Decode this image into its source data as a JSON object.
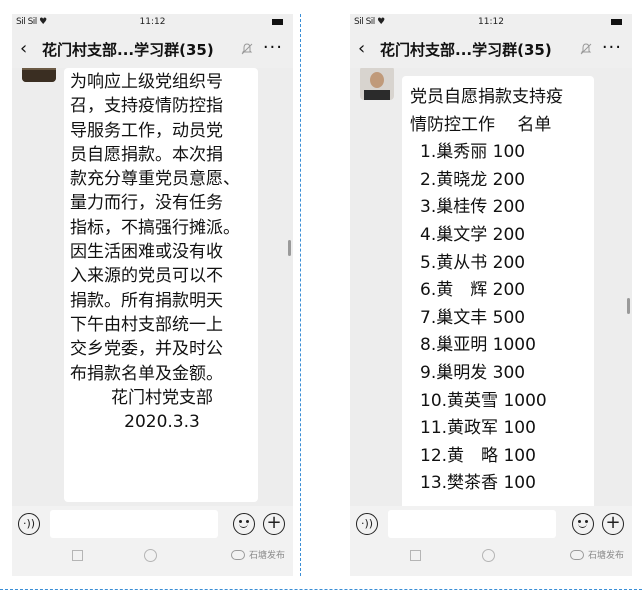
{
  "status_bar": {
    "signal": "Sil Sil ♥",
    "time": "11:12"
  },
  "chat": {
    "title": "花门村支部...学习群(35)",
    "back_icon": "‹",
    "more_icon": "···"
  },
  "message_left": {
    "lines": [
      "为响应上级党组织号",
      "召，支持疫情防控指",
      "导服务工作，动员党",
      "员自愿捐款。本次捐",
      "款充分尊重党员意愿、",
      "量力而行，没有任务",
      "指标，不搞强行摊派。",
      "因生活困难或没有收",
      "入来源的党员可以不",
      "捐款。所有捐款明天",
      "下午由村支部统一上",
      "交乡党委，并及时公",
      "布捐款名单及金额。"
    ],
    "signature": "花门村党支部",
    "date": "2020.3.3"
  },
  "message_right": {
    "heading_line1": "党员自愿捐款支持疫",
    "heading_line2": "情防控工作　 名单",
    "items": [
      "1.巢秀丽 100",
      "2.黄晓龙 200",
      "3.巢桂传 200",
      "4.巢文学 200",
      "5.黄从书 200",
      "6.黄　辉 200",
      "7.巢文丰 500",
      "8.巢亚明 1000",
      "9.巢明发 300",
      "10.黄英雪 1000",
      "11.黄政军 100",
      "12.黄　略 100",
      "13.樊茶香 100"
    ]
  },
  "input_bar": {
    "voice_icon": "·))",
    "plus_icon": "+"
  },
  "watermark": "石塘发布",
  "colors": {
    "divider": "#3a8ed6",
    "chat_bg": "#ededed",
    "bubble": "#ffffff"
  }
}
